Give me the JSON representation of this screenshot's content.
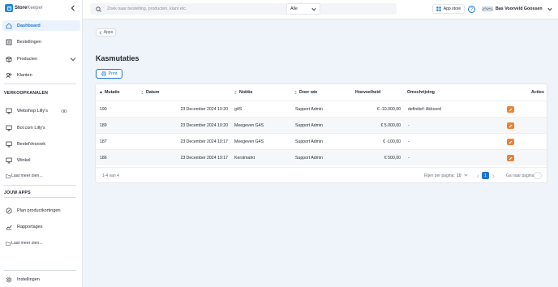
{
  "brand": {
    "name_bold": "Store",
    "name_light": "Keeper"
  },
  "sidebar": {
    "main_items": [
      {
        "label": "Dashboard",
        "icon": "home-icon",
        "active": true
      },
      {
        "label": "Bestellingen",
        "icon": "orders-icon"
      },
      {
        "label": "Producten",
        "icon": "box-icon"
      },
      {
        "label": "Klanten",
        "icon": "people-icon"
      }
    ],
    "section_sales": "VERKOOPKANALEN",
    "sales_items": [
      {
        "label": "Webshop Lilly's",
        "icon": "monitor-icon"
      },
      {
        "label": "Bol.com Lilly's",
        "icon": "monitor-icon"
      },
      {
        "label": "BestelVerzoek",
        "icon": "monitor-icon"
      },
      {
        "label": "Winkel",
        "icon": "monitor-icon"
      }
    ],
    "more_label": "Laat meer zien...",
    "section_apps": "JOUW APPS",
    "app_items": [
      {
        "label": "Plan productkortingen",
        "icon": "discount-icon"
      },
      {
        "label": "Rapportages",
        "icon": "chart-icon"
      }
    ],
    "settings_label": "Instellingen"
  },
  "header": {
    "search_placeholder": "Zoek naar bestelling, producten, klant etc.",
    "search_scope": "Alle",
    "app_store_label": "App store",
    "help_label": "?",
    "user_name": "Bas Voorveld Goossen"
  },
  "main": {
    "back_label": "Apps",
    "title": "Kasmutaties",
    "print_label": "Print",
    "columns": [
      "Mutatie",
      "Datum",
      "Notitie",
      "Door wie",
      "Hoeveelheid",
      "Omschrijving",
      "Acties"
    ],
    "rows": [
      {
        "mutatie": "190",
        "datum": "23 December 2024 10:20",
        "notitie": "g4S",
        "door": "Support Admin",
        "hoeveelheid": "€ -10.000,00",
        "omschrijving": "definitief: Akkoord"
      },
      {
        "mutatie": "189",
        "datum": "23 December 2024 10:20",
        "notitie": "Meegeven G4S",
        "door": "Support Admin",
        "hoeveelheid": "€ 5.000,00",
        "omschrijving": "-"
      },
      {
        "mutatie": "187",
        "datum": "23 December 2024 10:17",
        "notitie": "Meegeven G4S",
        "door": "Support Admin",
        "hoeveelheid": "€ -100,00",
        "omschrijving": "-"
      },
      {
        "mutatie": "186",
        "datum": "23 December 2024 10:17",
        "notitie": "Kerstmarkt",
        "door": "Support Admin",
        "hoeveelheid": "€ 500,00",
        "omschrijving": "-"
      }
    ],
    "footer": {
      "range": "1-4 van 4",
      "rows_per_page_label": "Rijen per pagina:",
      "rows_per_page": "10",
      "current_page": "1",
      "goto_label": "Ga naar pagina:"
    }
  },
  "colors": {
    "accent": "#1976d2",
    "edit": "#e8833a",
    "background": "#eef4f9"
  }
}
